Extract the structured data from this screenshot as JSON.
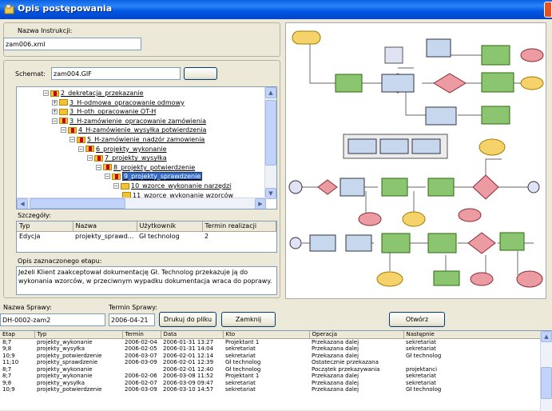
{
  "window": {
    "title": "Opis postępowania"
  },
  "instruction": {
    "label": "Nazwa Instrukcji:",
    "value": "zam006.xml"
  },
  "schema": {
    "label": "Schemat:",
    "value": "zam004.GIF",
    "browse_label": ""
  },
  "tree": {
    "items": [
      {
        "label": "2_dekretacja_przekazanie",
        "toggle": "−",
        "depth": 0,
        "icon": "folder-red"
      },
      {
        "label": "3_H-odmowa_opracowanie odmowy",
        "toggle": "+",
        "depth": 1,
        "icon": "folder"
      },
      {
        "label": "3_H-oth_opracowanie OT-H",
        "toggle": "+",
        "depth": 1,
        "icon": "folder"
      },
      {
        "label": "3_H-zamówienie_opracowanie zamówienia",
        "toggle": "−",
        "depth": 1,
        "icon": "folder-red"
      },
      {
        "label": "4_H-zamówienie_wysyłka potwierdzenia",
        "toggle": "−",
        "depth": 2,
        "icon": "folder-red"
      },
      {
        "label": "5_H-zamówienie_nadzór zamowienia",
        "toggle": "−",
        "depth": 3,
        "icon": "folder-red"
      },
      {
        "label": "6_projekty_wykonanie",
        "toggle": "−",
        "depth": 4,
        "icon": "folder-red"
      },
      {
        "label": "7_projekty_wysyłka",
        "toggle": "−",
        "depth": 5,
        "icon": "folder-red"
      },
      {
        "label": "8_projekty_potwierdzenie",
        "toggle": "−",
        "depth": 6,
        "icon": "folder-red"
      },
      {
        "label": "9_projekty_sprawdzenie",
        "toggle": "−",
        "depth": 7,
        "icon": "folder-red",
        "selected": true
      },
      {
        "label": "10_wzorce_wykonanie narzędzi",
        "toggle": "−",
        "depth": 8,
        "icon": "folder"
      },
      {
        "label": "11_wzorce_wykonanie wzorców",
        "toggle": "",
        "depth": 9,
        "icon": "folder"
      }
    ]
  },
  "details": {
    "label": "Szczegóły:",
    "columns": [
      "Typ",
      "Nazwa",
      "Użytkownik",
      "Termin realizacji"
    ],
    "rows": [
      [
        "Edycja",
        "projekty_sprawd...",
        "Gł technolog",
        "2"
      ]
    ]
  },
  "description": {
    "label": "Opis zaznaczonego etapu:",
    "text": "Jeżeli Klient zaakceptował dokumentację Gł. Technolog przekazuje ją do wykonania wzorców, w przeciwnym wypadku dokumentacja wraca do poprawy."
  },
  "case": {
    "name_label": "Nazwa Sprawy:",
    "name_value": "DH-0002-zam2",
    "date_label": "Termin Sprawy:",
    "date_value": "2006-04-21",
    "print_button": "Drukuj do pliku",
    "close_button": "Zamknij",
    "open_button": "Otwórz"
  },
  "history": {
    "columns": [
      "Etap",
      "Typ",
      "Termin",
      "Data",
      "Kto",
      "Operacja",
      "Następnie"
    ],
    "rows": [
      [
        "8;7",
        "projekty_wykonanie",
        "2006-02-04",
        "2006-01-31 13:27",
        "Projektant 1",
        "Przekazana dalej",
        "sekretariat"
      ],
      [
        "9;8",
        "projekty_wysyłka",
        "2006-02-05",
        "2006-01-31 14:04",
        "sekretariat",
        "Przekazana dalej",
        "sekretariat"
      ],
      [
        "10;9",
        "projekty_potwierdzenie",
        "2006-03-07",
        "2006-02-01 12:14",
        "sekretariat",
        "Przekazana dalej",
        "Gł technolog"
      ],
      [
        "11;10",
        "projekty_sprawdzenie",
        "2006-03-09",
        "2006-02-01 12:39",
        "Gł technolog",
        "Ostatecznie przekazana",
        ""
      ],
      [
        "8;7",
        "projekty_wykonanie",
        "",
        "2006-02-01 12:40",
        "Gł technolog",
        "Początek przekazywania",
        "projektanci"
      ],
      [
        "8;7",
        "projekty_wykonanie",
        "2006-02-06",
        "2006-03-08 11:52",
        "Projektant 1",
        "Przekazana dalej",
        "sekretariat"
      ],
      [
        "9;8",
        "projekty_wysyłka",
        "2006-02-07",
        "2006-03-09 09:47",
        "sekretariat",
        "Przekazana dalej",
        "sekretariat"
      ],
      [
        "10;9",
        "projekty_potwierdzenie",
        "2006-03-09",
        "2006-03-10 14:57",
        "sekretariat",
        "Przekazana dalej",
        "Gł technolog"
      ]
    ]
  },
  "colors": {
    "titlebar": "#0054e3",
    "selection": "#316ac5",
    "window_bg": "#ece9d8"
  },
  "icons": {
    "title": "document-icon",
    "close": "close-icon",
    "folder": "folder-icon"
  }
}
